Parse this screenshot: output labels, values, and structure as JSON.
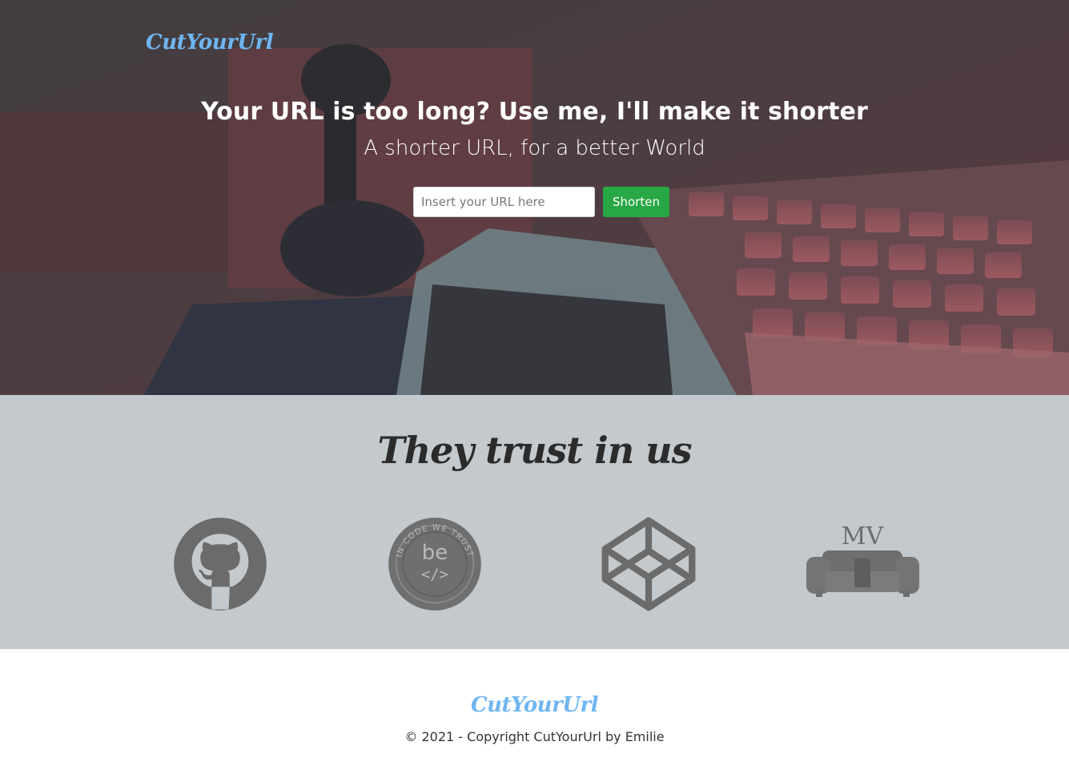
{
  "header": {
    "brand": "CutYourUrl"
  },
  "hero": {
    "title": "Your URL is too long? Use me, I'll make it shorter",
    "subtitle": "A shorter URL, for a better World",
    "input_placeholder": "Insert your URL here",
    "input_value": "",
    "submit_label": "Shorten",
    "background_image": "retro-computer-joystick-keyboard-photo"
  },
  "trust": {
    "title": "They trust in us",
    "partners": [
      {
        "name": "GitHub",
        "icon": "github-icon"
      },
      {
        "name": "BeCode",
        "icon": "becode-badge-icon",
        "badge_text_top": "IN CODE WE TRUST",
        "badge_text_mid": "be",
        "badge_text_code": "</>"
      },
      {
        "name": "CodePen",
        "icon": "codepen-icon"
      },
      {
        "name": "MV",
        "icon": "sofa-logo-icon",
        "logo_text": "MV"
      }
    ]
  },
  "footer": {
    "brand": "CutYourUrl",
    "copyright": "© 2021 - Copyright CutYourUrl by Emilie"
  },
  "colors": {
    "brand": "#6fb6f2",
    "button": "#28a745",
    "trust_bg": "#c3c9cc",
    "icon_gray": "#6b6b6b"
  }
}
